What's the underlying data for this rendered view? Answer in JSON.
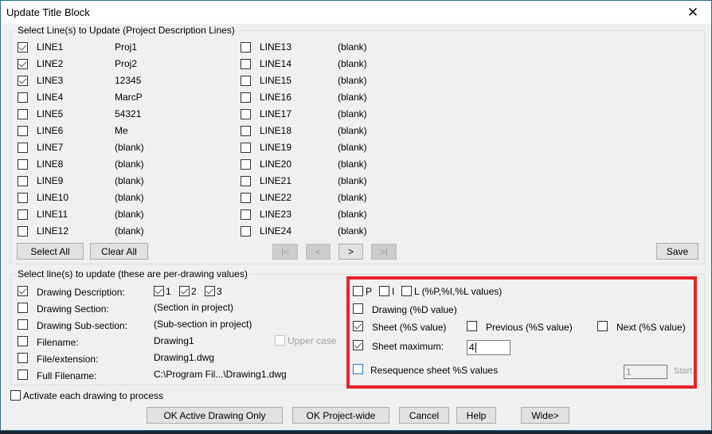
{
  "window": {
    "title": "Update Title Block",
    "close_label": "✕"
  },
  "project_lines": {
    "group_label": "Select Line(s) to Update (Project Description Lines)",
    "left": [
      {
        "name": "LINE1",
        "value": "Proj1",
        "checked": true
      },
      {
        "name": "LINE2",
        "value": "Proj2",
        "checked": true
      },
      {
        "name": "LINE3",
        "value": "12345",
        "checked": true
      },
      {
        "name": "LINE4",
        "value": "MarcP",
        "checked": false
      },
      {
        "name": "LINE5",
        "value": "54321",
        "checked": false
      },
      {
        "name": "LINE6",
        "value": "Me",
        "checked": false
      },
      {
        "name": "LINE7",
        "value": "(blank)",
        "checked": false
      },
      {
        "name": "LINE8",
        "value": "(blank)",
        "checked": false
      },
      {
        "name": "LINE9",
        "value": "(blank)",
        "checked": false
      },
      {
        "name": "LINE10",
        "value": "(blank)",
        "checked": false
      },
      {
        "name": "LINE11",
        "value": "(blank)",
        "checked": false
      },
      {
        "name": "LINE12",
        "value": "(blank)",
        "checked": false
      }
    ],
    "right": [
      {
        "name": "LINE13",
        "value": "(blank)",
        "checked": false
      },
      {
        "name": "LINE14",
        "value": "(blank)",
        "checked": false
      },
      {
        "name": "LINE15",
        "value": "(blank)",
        "checked": false
      },
      {
        "name": "LINE16",
        "value": "(blank)",
        "checked": false
      },
      {
        "name": "LINE17",
        "value": "(blank)",
        "checked": false
      },
      {
        "name": "LINE18",
        "value": "(blank)",
        "checked": false
      },
      {
        "name": "LINE19",
        "value": "(blank)",
        "checked": false
      },
      {
        "name": "LINE20",
        "value": "(blank)",
        "checked": false
      },
      {
        "name": "LINE21",
        "value": "(blank)",
        "checked": false
      },
      {
        "name": "LINE22",
        "value": "(blank)",
        "checked": false
      },
      {
        "name": "LINE23",
        "value": "(blank)",
        "checked": false
      },
      {
        "name": "LINE24",
        "value": "(blank)",
        "checked": false
      }
    ],
    "select_all_label": "Select All",
    "clear_all_label": "Clear All",
    "nav_first_label": "|<",
    "nav_prev_label": "<",
    "nav_next_label": ">",
    "nav_last_label": ">|",
    "save_label": "Save"
  },
  "drawing_values": {
    "group_label": "Select line(s) to update (these are per-drawing values)",
    "rows": [
      {
        "label": "Drawing Description:",
        "value": "",
        "checked": true
      },
      {
        "label": "Drawing Section:",
        "value": "(Section in project)",
        "checked": false
      },
      {
        "label": "Drawing Sub-section:",
        "value": "(Sub-section in project)",
        "checked": false
      },
      {
        "label": "Filename:",
        "value": "Drawing1",
        "checked": false
      },
      {
        "label": "File/extension:",
        "value": "Drawing1.dwg",
        "checked": false
      },
      {
        "label": "Full Filename:",
        "value": "C:\\Program Fil...\\Drawing1.dwg",
        "checked": false
      }
    ],
    "desc_parts": [
      {
        "label": "1",
        "checked": true
      },
      {
        "label": "2",
        "checked": true
      },
      {
        "label": "3",
        "checked": true
      }
    ],
    "upper_case_label": "Upper case",
    "upper_case_checked": false,
    "p_label": "P",
    "i_label": "I",
    "l_label": "L (%P,%I,%L values)",
    "drawing_label": "Drawing (%D value)",
    "sheet_label": "Sheet (%S value)",
    "sheet_checked": true,
    "previous_label": "Previous (%S value)",
    "next_label": "Next (%S value)",
    "sheet_max_label": "Sheet maximum:",
    "sheet_max_checked": true,
    "sheet_max_value": "4",
    "resequence_label": "Resequence sheet %S values",
    "resequence_checked": false,
    "start_value": "1",
    "start_label": "Start"
  },
  "activate_label": "Activate each drawing to process",
  "footer": {
    "ok_active_label": "OK Active Drawing Only",
    "ok_project_label": "OK Project-wide",
    "cancel_label": "Cancel",
    "help_label": "Help",
    "wide_label": "Wide>"
  },
  "highlight_color": "#e8212a"
}
